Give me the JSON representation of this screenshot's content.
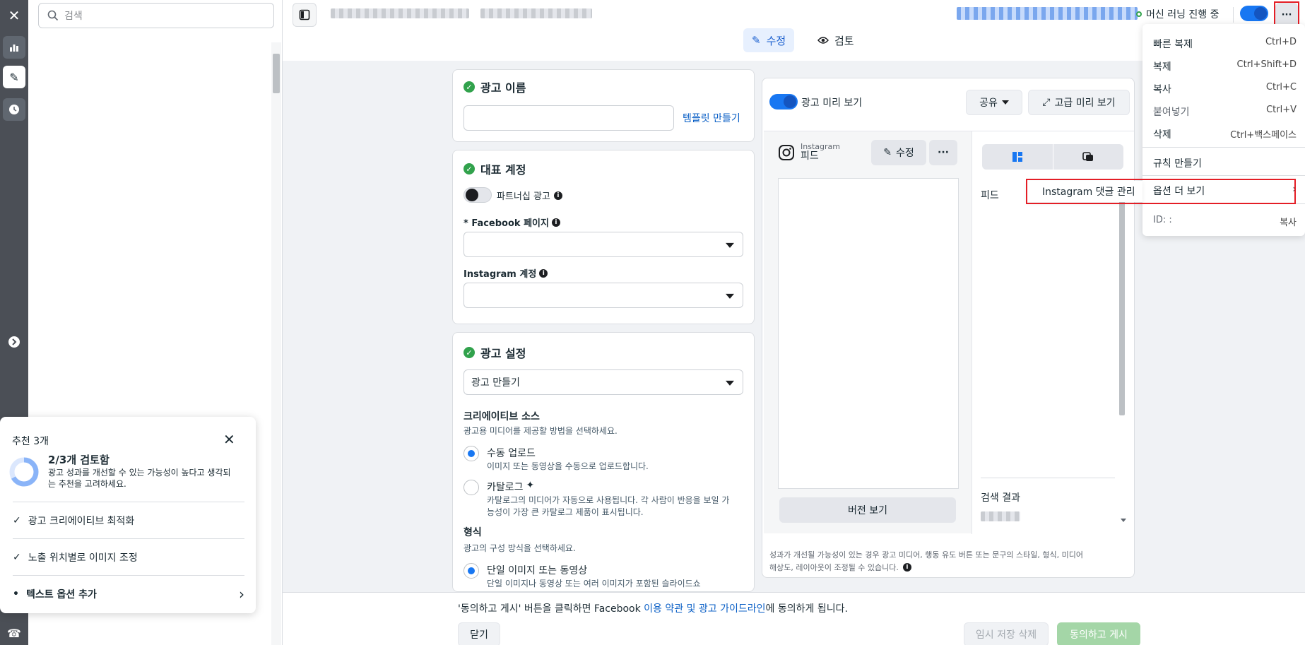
{
  "sidebar": {
    "search_placeholder": "검색"
  },
  "header": {
    "tabs": [
      {
        "label": "수정"
      },
      {
        "label": "검토"
      }
    ],
    "ml_status": "머신 러닝 진행 중"
  },
  "menu": {
    "items": [
      {
        "label": "빠른 복제",
        "shortcut": "Ctrl+D"
      },
      {
        "label": "복제",
        "shortcut": "Ctrl+Shift+D"
      },
      {
        "label": "복사",
        "shortcut": "Ctrl+C"
      },
      {
        "label": "붙여넣기",
        "shortcut": "Ctrl+V"
      },
      {
        "label": "삭제",
        "shortcut": "Ctrl+백스페이스"
      }
    ],
    "create_rule": "규칙 만들기",
    "more_options": "옵션 더 보기",
    "id_label": "ID: :",
    "id_copy": "복사",
    "submenu_item": "Instagram 댓글 관리"
  },
  "ad_name": {
    "title": "광고 이름",
    "template_link": "템플릿 만들기"
  },
  "identity": {
    "title": "대표 계정",
    "partnership_label": "파트너십 광고",
    "facebook_page_label": "* Facebook 페이지",
    "instagram_label": "Instagram 계정"
  },
  "ad_setup": {
    "title": "광고 설정",
    "select_value": "광고 만들기",
    "creative_source_title": "크리에이티브 소스",
    "creative_source_desc": "광고용 미디어를 제공할 방법을 선택하세요.",
    "manual_title": "수동 업로드",
    "manual_desc": "이미지 또는 동영상을 수동으로 업로드합니다.",
    "catalog_title": "카탈로그",
    "catalog_desc_1": "카탈로그의 미디어가 자동으로 사용됩니다. 각 사람이 반응을 보일 가",
    "catalog_desc_2": "능성이 가장 큰 카탈로그 제품이 표시됩니다.",
    "format_title": "형식",
    "format_desc": "광고의 구성 방식을 선택하세요.",
    "single_title": "단일 이미지 또는 동영상",
    "single_desc": "단일 이미지나 동영상 또는 여러 이미지가 포함된 슬라이드쇼"
  },
  "preview": {
    "toggle_label": "광고 미리 보기",
    "share_label": "공유",
    "advanced_label": "고급 미리 보기",
    "platform": "Instagram",
    "placement": "피드",
    "edit_label": "수정",
    "version_button": "버전 보기",
    "feed_label": "피드",
    "search_results_label": "검색 결과",
    "footer_note_1": "성과가 개선될 가능성이 있는 경우 광고 미디어, 행동 유도 버튼 또는 문구의 스타일, 형식, 미디어",
    "footer_note_2": "해상도, 레이아웃이 조정될 수 있습니다."
  },
  "recommendations": {
    "title": "추천 3개",
    "progress_title": "2/3개 검토함",
    "progress_fraction": 0.67,
    "progress_desc_1": "광고 성과를 개선할 수 있는 가능성이 높다고 생각되",
    "progress_desc_2": "는 추천을 고려하세요.",
    "items": [
      {
        "label": "광고 크리에이티브 최적화",
        "done": true
      },
      {
        "label": "노출 위치별로 이미지 조정",
        "done": true
      },
      {
        "label": "텍스트 옵션 추가",
        "done": false
      }
    ]
  },
  "footer": {
    "agree_prefix": "'동의하고 게시' 버튼을 클릭하면 Facebook ",
    "terms_link": "이용 약관 및 광고 가이드라인",
    "agree_suffix": "에 동의하게 됩니다.",
    "close_button": "닫기",
    "discard_button": "임시 저장 삭제",
    "publish_button": "동의하고 게시"
  },
  "colors": {
    "accent": "#1877f2",
    "success": "#31a24c",
    "highlight_border": "#e41e26",
    "publish_disabled": "#a4d6a7"
  }
}
